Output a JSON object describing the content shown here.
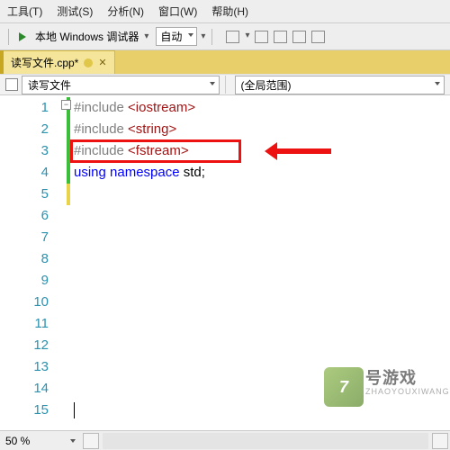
{
  "menu": {
    "tools": "工具(T)",
    "test": "测试(S)",
    "analyze": "分析(N)",
    "window": "窗口(W)",
    "help": "帮助(H)"
  },
  "toolbar": {
    "debugger": "本地 Windows 调试器",
    "config": "自动"
  },
  "tab": {
    "filename": "读写文件.cpp*"
  },
  "nav": {
    "left": "读写文件",
    "right": "(全局范围)"
  },
  "gutter": [
    "1",
    "2",
    "3",
    "4",
    "5",
    "6",
    "7",
    "8",
    "9",
    "10",
    "11",
    "12",
    "13",
    "14",
    "15"
  ],
  "code": {
    "l1a": "#include ",
    "l1b": "<iostream>",
    "l2a": "#include ",
    "l2b": "<string>",
    "l3a": "#include ",
    "l3b": "<fstream>",
    "l4a": "using ",
    "l4b": "namespace ",
    "l4c": "std",
    "l4d": ";"
  },
  "zoom": "50 %",
  "watermark": {
    "num": "7",
    "text": "号游戏",
    "sub": "ZHAOYOUXIWANG"
  }
}
